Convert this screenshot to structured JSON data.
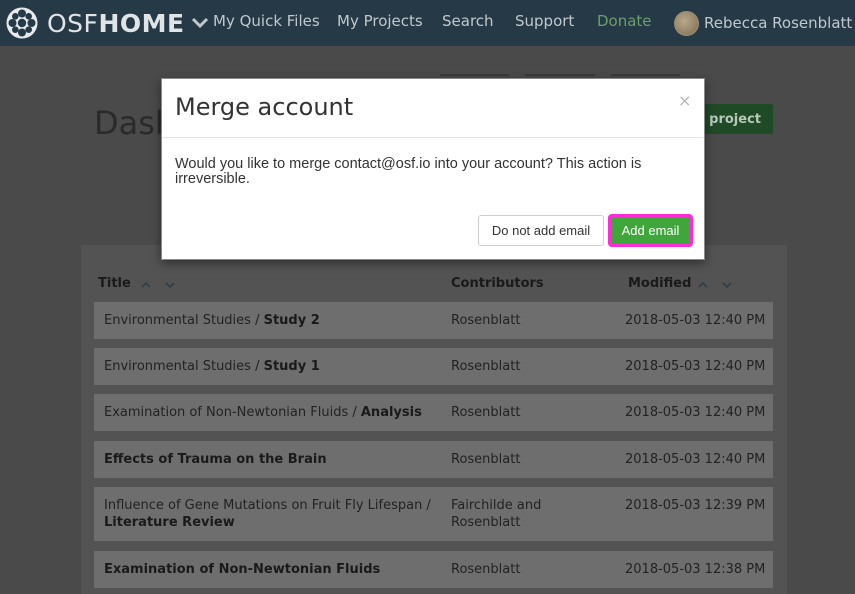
{
  "navbar": {
    "brand_light": "OSF",
    "brand_bold": "HOME",
    "links": [
      "My Quick Files",
      "My Projects",
      "Search",
      "Support",
      "Donate"
    ],
    "user_name": "Rebecca Rosenblatt"
  },
  "page": {
    "title": "Dashboard",
    "create_button": "Create new project"
  },
  "table": {
    "headers": {
      "title": "Title",
      "contributors": "Contributors",
      "modified": "Modified"
    },
    "rows": [
      {
        "parent": "Environmental Studies / ",
        "name": "Study 2",
        "contributors": "Rosenblatt",
        "modified": "2018-05-03 12:40 PM"
      },
      {
        "parent": "Environmental Studies / ",
        "name": "Study 1",
        "contributors": "Rosenblatt",
        "modified": "2018-05-03 12:40 PM"
      },
      {
        "parent": "Examination of Non-Newtonian Fluids / ",
        "name": "Analysis",
        "contributors": "Rosenblatt",
        "modified": "2018-05-03 12:40 PM"
      },
      {
        "parent": "",
        "name": "Effects of Trauma on the Brain",
        "contributors": "Rosenblatt",
        "modified": "2018-05-03 12:40 PM"
      },
      {
        "parent": "Influence of Gene Mutations on Fruit Fly Lifespan / ",
        "name": "Literature Review",
        "contributors": "Fairchilde and Rosenblatt",
        "modified": "2018-05-03 12:39 PM"
      },
      {
        "parent": "",
        "name": "Examination of Non-Newtonian Fluids",
        "contributors": "Rosenblatt",
        "modified": "2018-05-03 12:38 PM"
      }
    ]
  },
  "modal": {
    "title": "Merge account",
    "close_glyph": "×",
    "body": "Would you like to merge contact@osf.io into your account? This action is irreversible.",
    "cancel_label": "Do not add email",
    "confirm_label": "Add email"
  },
  "colors": {
    "navbar": "#263947",
    "overlay_page": "#4a4a4a",
    "primary_button": "#3fa63b",
    "focus_outline": "#ff2bd6"
  }
}
